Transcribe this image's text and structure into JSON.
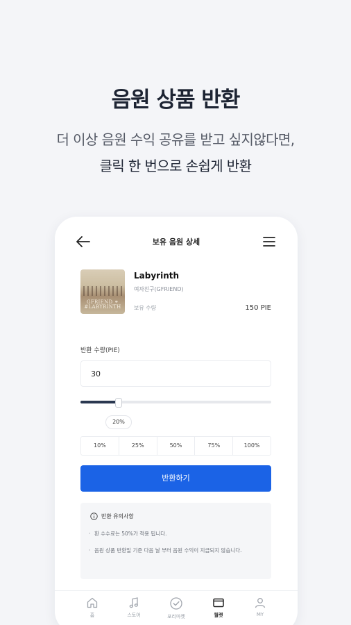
{
  "hero": {
    "title": "음원 상품 반환",
    "subtitle_line1": "더 이상 음원 수익 공유를 받고 싶지않다면,",
    "subtitle_line2": "클릭 한 번으로 손쉽게 반환"
  },
  "screen": {
    "title": "보유 음원 상세",
    "icons": {
      "back": "arrow-left-icon",
      "menu": "hamburger-menu-icon"
    }
  },
  "song": {
    "title": "Labyrinth",
    "artist": "여자친구(GFRIEND)",
    "cover_text_line1": "GFRIEND ⚭",
    "cover_text_line2": "#LABYRINTH",
    "holding_label": "보유 수량",
    "holding_value": "150 PIE"
  },
  "return_form": {
    "quantity_label": "반환 수량(PIE)",
    "quantity_value": "30",
    "slider_percent": 20,
    "slider_label": "20%",
    "presets": [
      "10%",
      "25%",
      "50%",
      "75%",
      "100%"
    ],
    "submit_label": "반환하기"
  },
  "notice": {
    "title": "반환 유의사항",
    "items": [
      "환 수수료는 50%가 적용 됩니다.",
      "음원 상품 반환일 기준 다음 날 부터 음원 수익이 지급되지 않습니다."
    ]
  },
  "tabs": [
    {
      "label": "홈",
      "icon": "home-icon"
    },
    {
      "label": "스토어",
      "icon": "music-note-icon"
    },
    {
      "label": "포리마켓",
      "icon": "check-badge-icon"
    },
    {
      "label": "월렛",
      "icon": "wallet-icon",
      "active": true
    },
    {
      "label": "MY",
      "icon": "user-icon"
    }
  ],
  "colors": {
    "accent": "#1b63e6",
    "slider_fill": "#2a3850",
    "background": "#f4f5f8"
  }
}
